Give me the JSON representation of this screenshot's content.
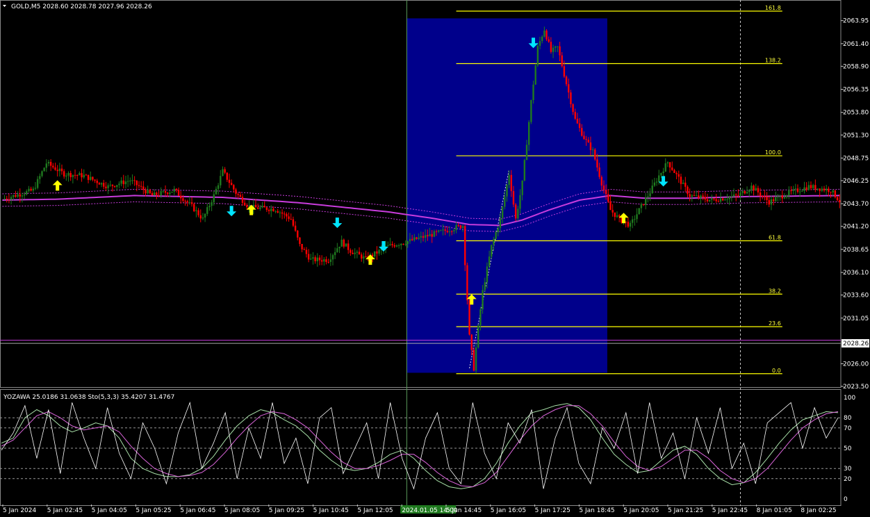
{
  "main_header": "GOLD,M5  2028.60 2028.78 2027.96 2028.26",
  "sub_header": "YOZAWA 25.0186 31.0638  Sto(5,3,3) 35.4207 31.4767",
  "current_price_label": "2028.26",
  "colors": {
    "background": "#000000",
    "bull_candle": "#1f7a1f",
    "bear_candle": "#ff0000",
    "moving_average": "#c83cdc",
    "fib_level": "#ffff00",
    "highlight_box": "#00008b",
    "buy_arrow": "#ffff00",
    "sell_arrow": "#00e5ff",
    "stoch_main": "#a8e0a8",
    "stoch_signal": "#dd66dd",
    "oscillator": "#ffffff"
  },
  "chart_data": [
    {
      "type": "candlestick",
      "symbol": "GOLD",
      "timeframe": "M5",
      "ylim": [
        2023.5,
        2065.0
      ],
      "y_ticks": [
        "2063.95",
        "2061.40",
        "2058.90",
        "2056.35",
        "2053.80",
        "2051.30",
        "2048.75",
        "2046.25",
        "2043.70",
        "2041.20",
        "2038.65",
        "2036.10",
        "2033.60",
        "2031.05",
        "2026.00",
        "2023.50"
      ],
      "x_ticks": [
        "5 Jan 2024",
        "5 Jan 02:45",
        "5 Jan 04:05",
        "5 Jan 05:25",
        "5 Jan 06:45",
        "5 Jan 08:05",
        "5 Jan 09:25",
        "5 Jan 10:45",
        "5 Jan 12:05",
        "2024.01.05 14:00",
        "5 Jan 14:45",
        "5 Jan 16:05",
        "5 Jan 17:25",
        "5 Jan 18:45",
        "5 Jan 20:05",
        "5 Jan 21:25",
        "5 Jan 22:45",
        "8 Jan 01:05",
        "8 Jan 02:25"
      ],
      "x_tick_highlight_index": 9,
      "price_path": [
        [
          0,
          2044.2
        ],
        [
          14,
          2045.2
        ],
        [
          20,
          2048.2
        ],
        [
          28,
          2047.0
        ],
        [
          37,
          2046.8
        ],
        [
          48,
          2045.6
        ],
        [
          58,
          2046.3
        ],
        [
          68,
          2044.6
        ],
        [
          78,
          2045.2
        ],
        [
          86,
          2043.4
        ],
        [
          91,
          2042.0
        ],
        [
          96,
          2044.6
        ],
        [
          100,
          2047.3
        ],
        [
          106,
          2044.9
        ],
        [
          112,
          2043.3
        ],
        [
          124,
          2043.1
        ],
        [
          131,
          2042.0
        ],
        [
          135,
          2039.1
        ],
        [
          140,
          2037.5
        ],
        [
          148,
          2037.5
        ],
        [
          154,
          2039.5
        ],
        [
          158,
          2038.5
        ],
        [
          165,
          2037.6
        ],
        [
          175,
          2039.0
        ],
        [
          185,
          2039.6
        ],
        [
          198,
          2040.5
        ],
        [
          209,
          2041.3
        ],
        [
          212,
          2029.0
        ],
        [
          214,
          2025.5
        ],
        [
          216,
          2030.0
        ],
        [
          218,
          2034.0
        ],
        [
          222,
          2039.0
        ],
        [
          226,
          2042.0
        ],
        [
          230,
          2047.0
        ],
        [
          233,
          2042.0
        ],
        [
          236,
          2046.0
        ],
        [
          240,
          2055.0
        ],
        [
          243,
          2061.0
        ],
        [
          246,
          2063.0
        ],
        [
          249,
          2060.5
        ],
        [
          252,
          2061.0
        ],
        [
          256,
          2057.0
        ],
        [
          260,
          2053.0
        ],
        [
          264,
          2051.0
        ],
        [
          268,
          2049.5
        ],
        [
          272,
          2046.0
        ],
        [
          276,
          2043.0
        ],
        [
          280,
          2042.0
        ],
        [
          285,
          2041.3
        ],
        [
          289,
          2043.0
        ],
        [
          294,
          2045.0
        ],
        [
          298,
          2046.8
        ],
        [
          302,
          2048.3
        ],
        [
          307,
          2046.5
        ],
        [
          312,
          2044.6
        ],
        [
          322,
          2044.1
        ],
        [
          334,
          2044.6
        ],
        [
          340,
          2045.6
        ],
        [
          348,
          2043.9
        ],
        [
          356,
          2044.8
        ],
        [
          366,
          2045.6
        ],
        [
          376,
          2045.2
        ],
        [
          380,
          2044.0
        ]
      ],
      "moving_average_path": [
        [
          0,
          2044.1
        ],
        [
          25,
          2044.2
        ],
        [
          60,
          2044.6
        ],
        [
          100,
          2044.4
        ],
        [
          135,
          2043.8
        ],
        [
          175,
          2042.8
        ],
        [
          195,
          2042.1
        ],
        [
          212,
          2041.4
        ],
        [
          226,
          2041.3
        ],
        [
          236,
          2041.9
        ],
        [
          248,
          2043.0
        ],
        [
          262,
          2044.1
        ],
        [
          276,
          2044.6
        ],
        [
          292,
          2044.3
        ],
        [
          310,
          2044.3
        ],
        [
          340,
          2044.5
        ],
        [
          380,
          2044.6
        ]
      ],
      "horizontal_lines": [
        {
          "name": "bid-line",
          "price": 2028.26,
          "color": "#aaaaaa"
        },
        {
          "name": "magenta-level",
          "price": 2028.6,
          "color": "#c83cdc"
        }
      ],
      "highlight_box": {
        "from_bar": 184,
        "to_bar": 275,
        "price_top": 2064.2,
        "price_bottom": 2025.0
      },
      "fibonacci": {
        "from_bar": 206,
        "to_bar": 354,
        "levels": [
          {
            "label": "161.8",
            "price": 2065.0
          },
          {
            "label": "138.2",
            "price": 2059.2
          },
          {
            "label": "100.0",
            "price": 2049.0
          },
          {
            "label": "61.8",
            "price": 2039.6
          },
          {
            "label": "38.2",
            "price": 2033.7
          },
          {
            "label": "23.6",
            "price": 2030.1
          },
          {
            "label": "0.0",
            "price": 2024.9
          }
        ]
      },
      "buy_signals": [
        {
          "bar": 25,
          "price": 2045.6
        },
        {
          "bar": 113,
          "price": 2042.9
        },
        {
          "bar": 167,
          "price": 2037.4
        },
        {
          "bar": 213,
          "price": 2033.0
        },
        {
          "bar": 282,
          "price": 2042.0
        }
      ],
      "sell_signals": [
        {
          "bar": 104,
          "price": 2043.0
        },
        {
          "bar": 152,
          "price": 2041.7
        },
        {
          "bar": 173,
          "price": 2039.1
        },
        {
          "bar": 241,
          "price": 2061.6
        },
        {
          "bar": 300,
          "price": 2046.3
        }
      ],
      "vertical_marker_bar": 184,
      "dashed_marker_bar": 335
    },
    {
      "type": "line",
      "name": "Stochastic",
      "ylim": [
        0,
        100
      ],
      "y_ticks": [
        "100",
        "80",
        "70",
        "50",
        "30",
        "20",
        "0"
      ],
      "levels": [
        80,
        70,
        50,
        30,
        20
      ],
      "series": [
        {
          "values": [
            55,
            60,
            80,
            88,
            82,
            72,
            66,
            70,
            75,
            72,
            60,
            40,
            30,
            25,
            22,
            22,
            24,
            30,
            42,
            58,
            72,
            82,
            88,
            85,
            78,
            72,
            62,
            48,
            38,
            30,
            28,
            30,
            36,
            44,
            48,
            40,
            28,
            18,
            12,
            10,
            12,
            20,
            35,
            55,
            72,
            85,
            88,
            92,
            94,
            90,
            78,
            60,
            44,
            34,
            26,
            28,
            38,
            48,
            52,
            44,
            30,
            20,
            14,
            16,
            26,
            40,
            55,
            68,
            78,
            82,
            86,
            85
          ]
        },
        {
          "values": [
            52,
            58,
            70,
            82,
            86,
            80,
            72,
            68,
            70,
            72,
            66,
            52,
            40,
            30,
            25,
            22,
            23,
            26,
            34,
            46,
            60,
            72,
            82,
            86,
            84,
            78,
            70,
            58,
            46,
            36,
            30,
            30,
            33,
            38,
            44,
            44,
            36,
            26,
            18,
            13,
            12,
            16,
            26,
            42,
            58,
            72,
            82,
            88,
            92,
            92,
            84,
            72,
            56,
            42,
            32,
            28,
            32,
            40,
            48,
            48,
            40,
            28,
            20,
            16,
            20,
            30,
            44,
            58,
            70,
            78,
            84,
            86
          ]
        },
        {
          "values": [
            48,
            65,
            92,
            40,
            88,
            25,
            95,
            60,
            30,
            90,
            45,
            20,
            75,
            50,
            15,
            65,
            95,
            30,
            55,
            85,
            20,
            70,
            40,
            95,
            35,
            60,
            15,
            80,
            90,
            25,
            50,
            75,
            20,
            95,
            40,
            10,
            60,
            85,
            30,
            15,
            95,
            45,
            20,
            75,
            55,
            88,
            10,
            60,
            90,
            35,
            15,
            70,
            50,
            85,
            25,
            95,
            40,
            65,
            20,
            80,
            45,
            90,
            30,
            55,
            15,
            75,
            85,
            95,
            50,
            90,
            60,
            80
          ]
        }
      ]
    }
  ]
}
